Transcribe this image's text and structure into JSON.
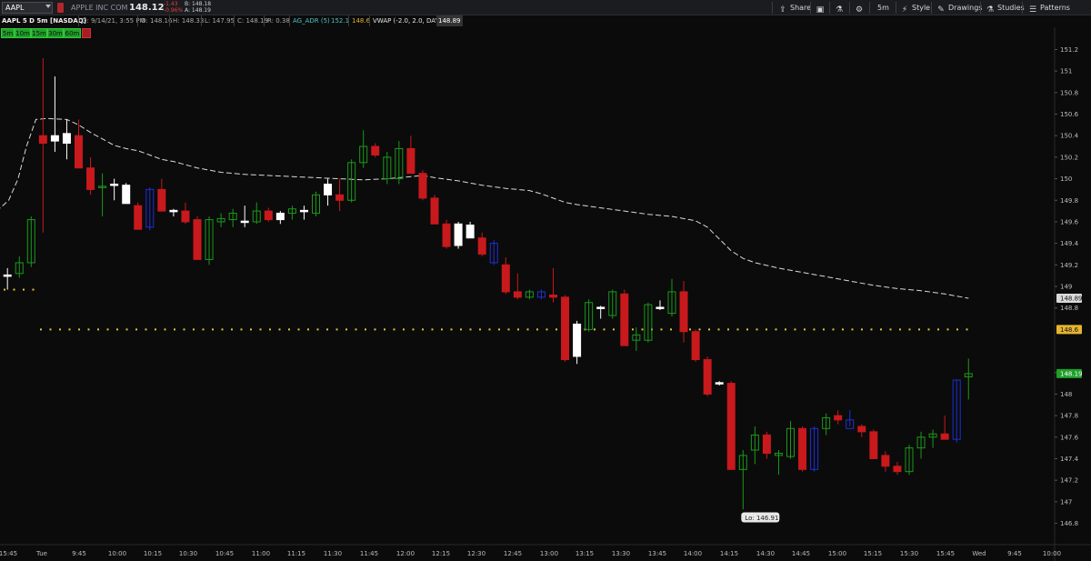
{
  "toolbar": {
    "symbol": "AAPL",
    "company": "APPLE INC COM",
    "last_price": "148.12",
    "change": "-1.43",
    "change_pct": "-0.96%",
    "bid": "B: 148.18",
    "ask": "A: 148.19",
    "buttons": {
      "share": "Share",
      "timeframe": "5m",
      "style": "Style",
      "drawings": "Drawings",
      "studies": "Studies",
      "patterns": "Patterns"
    }
  },
  "infobar": {
    "title": "AAPL 5 D 5m [NASDAQ]",
    "date": "D: 9/14/21, 3:55 PM",
    "open": "O: 148.16",
    "high": "H: 148.33",
    "low": "L: 147.95",
    "close": "C: 148.19",
    "range": "R: 0.38",
    "adr_label": "AG_ADR (5)",
    "adr_value": "152.1",
    "adr_value2": "148.6",
    "vwap_label": "VWAP (-2.0, 2.0, DAY)",
    "vwap_value": "148.89"
  },
  "timeframes": [
    "5m",
    "10m",
    "15m",
    "30m",
    "60m"
  ],
  "colors": {
    "up": "#1a9a1a",
    "down": "#c8191d",
    "up_blue": "#1f2fd8",
    "doji": "#ffffff",
    "vwap": "#d9d9d9",
    "adr_dots": "#e5c43a",
    "axis_text": "#bdbdbd"
  },
  "chart_data": {
    "type": "candlestick",
    "y_ticks": [
      "151.2",
      "151",
      "150.8",
      "150.6",
      "150.4",
      "150.2",
      "150",
      "149.8",
      "149.6",
      "149.4",
      "149.2",
      "149",
      "148.8",
      "148.2",
      "148",
      "147.8",
      "147.6",
      "147.4",
      "147.2",
      "147",
      "146.8"
    ],
    "ylim": [
      146.72,
      151.28
    ],
    "x_ticks": [
      "15:45",
      "Tue",
      "9:45",
      "10:00",
      "10:15",
      "10:30",
      "10:45",
      "11:00",
      "11:15",
      "11:30",
      "11:45",
      "12:00",
      "12:15",
      "12:30",
      "12:45",
      "13:00",
      "13:15",
      "13:30",
      "13:45",
      "14:00",
      "14:15",
      "14:30",
      "14:45",
      "15:00",
      "15:15",
      "15:30",
      "15:45",
      "Wed",
      "9:45",
      "10:00"
    ],
    "price_badges": [
      {
        "label": "148.89",
        "value": 148.89,
        "color": "#d9d9d9",
        "text_color": "#111111"
      },
      {
        "label": "148.6",
        "value": 148.6,
        "color": "#e5b431",
        "text_color": "#111111"
      },
      {
        "label": "148.19",
        "value": 148.19,
        "color": "#1f9e2a",
        "text_color": "#ffffff"
      }
    ],
    "low_label": "Lo: 146.91",
    "adr_levels": [
      {
        "value": 148.97,
        "scope": "prev"
      },
      {
        "value": 148.6,
        "scope": "today"
      }
    ],
    "candles": [
      {
        "o": 149.1,
        "h": 149.17,
        "l": 148.97,
        "c": 149.1,
        "k": "doji"
      },
      {
        "o": 149.12,
        "h": 149.28,
        "l": 149.08,
        "c": 149.22,
        "k": "up"
      },
      {
        "o": 149.22,
        "h": 149.65,
        "l": 149.18,
        "c": 149.62,
        "k": "up"
      },
      {
        "o": 150.33,
        "h": 151.12,
        "l": 149.5,
        "c": 150.4,
        "k": "down"
      },
      {
        "o": 150.4,
        "h": 150.95,
        "l": 150.25,
        "c": 150.35,
        "k": "white"
      },
      {
        "o": 150.42,
        "h": 150.55,
        "l": 150.18,
        "c": 150.33,
        "k": "white"
      },
      {
        "o": 150.4,
        "h": 150.55,
        "l": 150.1,
        "c": 150.1,
        "k": "down"
      },
      {
        "o": 150.1,
        "h": 150.2,
        "l": 149.85,
        "c": 149.9,
        "k": "down"
      },
      {
        "o": 149.92,
        "h": 150.05,
        "l": 149.65,
        "c": 149.93,
        "k": "up"
      },
      {
        "o": 149.94,
        "h": 150.0,
        "l": 149.8,
        "c": 149.95,
        "k": "white"
      },
      {
        "o": 149.94,
        "h": 149.96,
        "l": 149.77,
        "c": 149.77,
        "k": "white"
      },
      {
        "o": 149.75,
        "h": 149.78,
        "l": 149.53,
        "c": 149.53,
        "k": "down"
      },
      {
        "o": 149.55,
        "h": 149.92,
        "l": 149.52,
        "c": 149.9,
        "k": "up_blue"
      },
      {
        "o": 149.9,
        "h": 150.0,
        "l": 149.7,
        "c": 149.7,
        "k": "down"
      },
      {
        "o": 149.7,
        "h": 149.72,
        "l": 149.65,
        "c": 149.7,
        "k": "doji"
      },
      {
        "o": 149.7,
        "h": 149.78,
        "l": 149.58,
        "c": 149.6,
        "k": "down"
      },
      {
        "o": 149.62,
        "h": 149.65,
        "l": 149.25,
        "c": 149.25,
        "k": "down"
      },
      {
        "o": 149.25,
        "h": 149.65,
        "l": 149.2,
        "c": 149.62,
        "k": "up"
      },
      {
        "o": 149.6,
        "h": 149.68,
        "l": 149.55,
        "c": 149.63,
        "k": "up"
      },
      {
        "o": 149.62,
        "h": 149.72,
        "l": 149.55,
        "c": 149.68,
        "k": "up"
      },
      {
        "o": 149.7,
        "h": 149.75,
        "l": 149.55,
        "c": 149.6,
        "k": "doji"
      },
      {
        "o": 149.6,
        "h": 149.78,
        "l": 149.58,
        "c": 149.7,
        "k": "up"
      },
      {
        "o": 149.7,
        "h": 149.73,
        "l": 149.6,
        "c": 149.62,
        "k": "down"
      },
      {
        "o": 149.62,
        "h": 149.7,
        "l": 149.58,
        "c": 149.68,
        "k": "white"
      },
      {
        "o": 149.68,
        "h": 149.75,
        "l": 149.62,
        "c": 149.72,
        "k": "up"
      },
      {
        "o": 149.7,
        "h": 149.75,
        "l": 149.62,
        "c": 149.7,
        "k": "doji"
      },
      {
        "o": 149.68,
        "h": 149.88,
        "l": 149.65,
        "c": 149.85,
        "k": "up"
      },
      {
        "o": 149.95,
        "h": 150.0,
        "l": 149.75,
        "c": 149.85,
        "k": "white"
      },
      {
        "o": 149.85,
        "h": 150.0,
        "l": 149.7,
        "c": 149.8,
        "k": "down"
      },
      {
        "o": 149.8,
        "h": 150.18,
        "l": 149.78,
        "c": 150.15,
        "k": "up"
      },
      {
        "o": 150.15,
        "h": 150.45,
        "l": 150.1,
        "c": 150.3,
        "k": "up"
      },
      {
        "o": 150.3,
        "h": 150.33,
        "l": 150.2,
        "c": 150.22,
        "k": "down"
      },
      {
        "o": 150.0,
        "h": 150.25,
        "l": 149.95,
        "c": 150.2,
        "k": "up"
      },
      {
        "o": 150.0,
        "h": 150.35,
        "l": 149.95,
        "c": 150.28,
        "k": "up"
      },
      {
        "o": 150.28,
        "h": 150.4,
        "l": 150.2,
        "c": 150.05,
        "k": "down"
      },
      {
        "o": 150.05,
        "h": 150.08,
        "l": 149.8,
        "c": 149.82,
        "k": "down"
      },
      {
        "o": 149.82,
        "h": 149.85,
        "l": 149.58,
        "c": 149.58,
        "k": "down"
      },
      {
        "o": 149.58,
        "h": 149.62,
        "l": 149.35,
        "c": 149.37,
        "k": "down"
      },
      {
        "o": 149.38,
        "h": 149.6,
        "l": 149.35,
        "c": 149.58,
        "k": "white"
      },
      {
        "o": 149.57,
        "h": 149.6,
        "l": 149.45,
        "c": 149.45,
        "k": "white"
      },
      {
        "o": 149.45,
        "h": 149.5,
        "l": 149.28,
        "c": 149.3,
        "k": "down"
      },
      {
        "o": 149.4,
        "h": 149.43,
        "l": 149.2,
        "c": 149.22,
        "k": "up_blue"
      },
      {
        "o": 149.2,
        "h": 149.27,
        "l": 148.93,
        "c": 148.95,
        "k": "down"
      },
      {
        "o": 148.95,
        "h": 149.12,
        "l": 148.88,
        "c": 148.9,
        "k": "down"
      },
      {
        "o": 148.9,
        "h": 148.97,
        "l": 148.88,
        "c": 148.95,
        "k": "up"
      },
      {
        "o": 148.95,
        "h": 148.97,
        "l": 148.88,
        "c": 148.9,
        "k": "up_blue"
      },
      {
        "o": 148.92,
        "h": 149.17,
        "l": 148.85,
        "c": 148.9,
        "k": "down"
      },
      {
        "o": 148.9,
        "h": 148.92,
        "l": 148.3,
        "c": 148.32,
        "k": "down"
      },
      {
        "o": 148.35,
        "h": 148.68,
        "l": 148.28,
        "c": 148.65,
        "k": "white"
      },
      {
        "o": 148.6,
        "h": 148.88,
        "l": 148.58,
        "c": 148.85,
        "k": "up"
      },
      {
        "o": 148.8,
        "h": 148.82,
        "l": 148.7,
        "c": 148.8,
        "k": "doji"
      },
      {
        "o": 148.73,
        "h": 148.97,
        "l": 148.7,
        "c": 148.95,
        "k": "up"
      },
      {
        "o": 148.93,
        "h": 148.97,
        "l": 148.45,
        "c": 148.45,
        "k": "down"
      },
      {
        "o": 148.5,
        "h": 148.62,
        "l": 148.4,
        "c": 148.55,
        "k": "up"
      },
      {
        "o": 148.5,
        "h": 148.85,
        "l": 148.48,
        "c": 148.83,
        "k": "up"
      },
      {
        "o": 148.82,
        "h": 148.87,
        "l": 148.78,
        "c": 148.8,
        "k": "doji"
      },
      {
        "o": 148.75,
        "h": 149.07,
        "l": 148.72,
        "c": 148.95,
        "k": "up"
      },
      {
        "o": 148.95,
        "h": 149.05,
        "l": 148.48,
        "c": 148.58,
        "k": "down"
      },
      {
        "o": 148.58,
        "h": 148.6,
        "l": 148.3,
        "c": 148.32,
        "k": "down"
      },
      {
        "o": 148.32,
        "h": 148.35,
        "l": 147.98,
        "c": 148.0,
        "k": "down"
      },
      {
        "o": 148.1,
        "h": 148.12,
        "l": 148.08,
        "c": 148.1,
        "k": "doji"
      },
      {
        "o": 148.1,
        "h": 148.12,
        "l": 147.3,
        "c": 147.3,
        "k": "down"
      },
      {
        "o": 147.3,
        "h": 147.48,
        "l": 146.93,
        "c": 147.43,
        "k": "up"
      },
      {
        "o": 147.48,
        "h": 147.7,
        "l": 147.35,
        "c": 147.62,
        "k": "up"
      },
      {
        "o": 147.62,
        "h": 147.65,
        "l": 147.4,
        "c": 147.45,
        "k": "down"
      },
      {
        "o": 147.43,
        "h": 147.48,
        "l": 147.25,
        "c": 147.45,
        "k": "up"
      },
      {
        "o": 147.42,
        "h": 147.75,
        "l": 147.4,
        "c": 147.68,
        "k": "up"
      },
      {
        "o": 147.68,
        "h": 147.7,
        "l": 147.28,
        "c": 147.3,
        "k": "down"
      },
      {
        "o": 147.3,
        "h": 147.7,
        "l": 147.28,
        "c": 147.68,
        "k": "up_blue"
      },
      {
        "o": 147.68,
        "h": 147.82,
        "l": 147.62,
        "c": 147.78,
        "k": "up"
      },
      {
        "o": 147.8,
        "h": 147.85,
        "l": 147.72,
        "c": 147.76,
        "k": "down"
      },
      {
        "o": 147.76,
        "h": 147.85,
        "l": 147.7,
        "c": 147.68,
        "k": "up_blue"
      },
      {
        "o": 147.7,
        "h": 147.72,
        "l": 147.6,
        "c": 147.65,
        "k": "down"
      },
      {
        "o": 147.65,
        "h": 147.67,
        "l": 147.4,
        "c": 147.4,
        "k": "down"
      },
      {
        "o": 147.43,
        "h": 147.47,
        "l": 147.28,
        "c": 147.33,
        "k": "down"
      },
      {
        "o": 147.33,
        "h": 147.37,
        "l": 147.25,
        "c": 147.28,
        "k": "down"
      },
      {
        "o": 147.28,
        "h": 147.53,
        "l": 147.25,
        "c": 147.5,
        "k": "up"
      },
      {
        "o": 147.5,
        "h": 147.65,
        "l": 147.4,
        "c": 147.6,
        "k": "up"
      },
      {
        "o": 147.6,
        "h": 147.67,
        "l": 147.5,
        "c": 147.63,
        "k": "up"
      },
      {
        "o": 147.63,
        "h": 147.8,
        "l": 147.6,
        "c": 147.58,
        "k": "down"
      },
      {
        "o": 147.58,
        "h": 148.13,
        "l": 147.55,
        "c": 148.13,
        "k": "up_blue"
      },
      {
        "o": 148.16,
        "h": 148.33,
        "l": 147.95,
        "c": 148.19,
        "k": "up"
      }
    ],
    "vwap": [
      {
        "i": -2.4,
        "v": 149.73
      },
      {
        "i": -0.7,
        "v": 149.72
      },
      {
        "i": 0.1,
        "v": 149.8
      },
      {
        "i": 0.9,
        "v": 150.0
      },
      {
        "i": 1.6,
        "v": 150.3
      },
      {
        "i": 2.4,
        "v": 150.55
      },
      {
        "i": 3.3,
        "v": 150.56
      },
      {
        "i": 5.0,
        "v": 150.55
      },
      {
        "i": 6.0,
        "v": 150.5
      },
      {
        "i": 7.0,
        "v": 150.43
      },
      {
        "i": 9.0,
        "v": 150.31
      },
      {
        "i": 10.0,
        "v": 150.28
      },
      {
        "i": 11.0,
        "v": 150.26
      },
      {
        "i": 12.0,
        "v": 150.22
      },
      {
        "i": 13.0,
        "v": 150.18
      },
      {
        "i": 14.0,
        "v": 150.16
      },
      {
        "i": 16.0,
        "v": 150.1
      },
      {
        "i": 18.0,
        "v": 150.06
      },
      {
        "i": 20.0,
        "v": 150.04
      },
      {
        "i": 22.0,
        "v": 150.03
      },
      {
        "i": 24.0,
        "v": 150.02
      },
      {
        "i": 26.0,
        "v": 150.01
      },
      {
        "i": 28.0,
        "v": 150.0
      },
      {
        "i": 30.0,
        "v": 149.99
      },
      {
        "i": 32.0,
        "v": 150.0
      },
      {
        "i": 34.0,
        "v": 150.02
      },
      {
        "i": 35.0,
        "v": 150.03
      },
      {
        "i": 36.0,
        "v": 150.01
      },
      {
        "i": 38.0,
        "v": 149.98
      },
      {
        "i": 40.0,
        "v": 149.94
      },
      {
        "i": 42.0,
        "v": 149.91
      },
      {
        "i": 44.0,
        "v": 149.89
      },
      {
        "i": 45.0,
        "v": 149.86
      },
      {
        "i": 46.0,
        "v": 149.82
      },
      {
        "i": 47.0,
        "v": 149.78
      },
      {
        "i": 48.0,
        "v": 149.76
      },
      {
        "i": 50.0,
        "v": 149.73
      },
      {
        "i": 52.0,
        "v": 149.7
      },
      {
        "i": 54.0,
        "v": 149.67
      },
      {
        "i": 56.0,
        "v": 149.65
      },
      {
        "i": 58.0,
        "v": 149.61
      },
      {
        "i": 59.0,
        "v": 149.55
      },
      {
        "i": 60.0,
        "v": 149.44
      },
      {
        "i": 61.0,
        "v": 149.33
      },
      {
        "i": 62.0,
        "v": 149.26
      },
      {
        "i": 63.0,
        "v": 149.22
      },
      {
        "i": 65.0,
        "v": 149.17
      },
      {
        "i": 67.0,
        "v": 149.13
      },
      {
        "i": 69.0,
        "v": 149.09
      },
      {
        "i": 71.0,
        "v": 149.05
      },
      {
        "i": 73.0,
        "v": 149.01
      },
      {
        "i": 75.0,
        "v": 148.98
      },
      {
        "i": 77.0,
        "v": 148.96
      },
      {
        "i": 79.0,
        "v": 148.93
      },
      {
        "i": 80.0,
        "v": 148.91
      },
      {
        "i": 81.0,
        "v": 148.89
      }
    ]
  }
}
